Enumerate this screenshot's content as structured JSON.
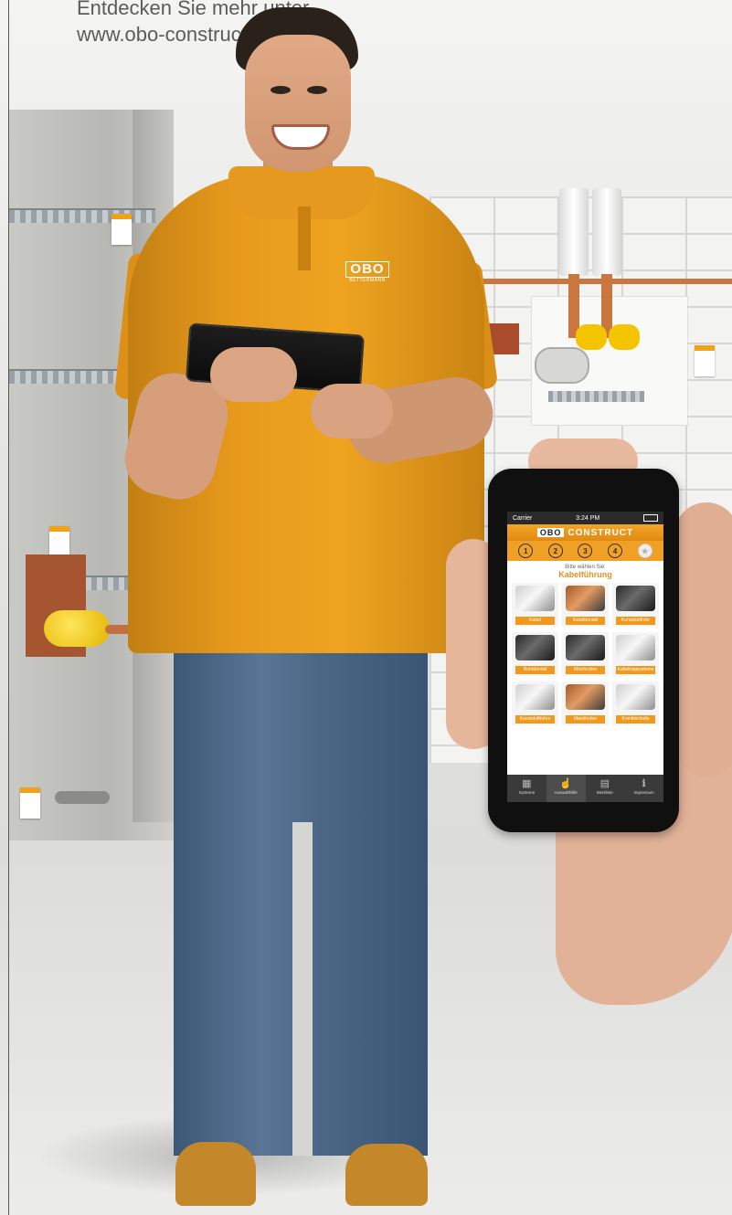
{
  "headline": {
    "line1": "Entdecken Sie mehr unter",
    "line2": "www.obo-construct.de"
  },
  "shirt_logo": {
    "mark": "OBO",
    "sub": "BETTERMANN"
  },
  "phone": {
    "status": {
      "carrier": "Carrier",
      "time": "3:24 PM"
    },
    "brand": {
      "logo": "OBO",
      "title": "CONSTRUCT"
    },
    "steps": [
      "1",
      "2",
      "3",
      "4",
      "★"
    ],
    "prompt": "Bitte wählen Sie:",
    "section_title": "Kabelführung",
    "tiles": [
      {
        "label": "Kabel",
        "style": "light"
      },
      {
        "label": "Kabelbündel",
        "style": "copper"
      },
      {
        "label": "Kunststoffrohr",
        "style": "dark"
      },
      {
        "label": "Rohrbündel",
        "style": "dark"
      },
      {
        "label": "Mischrohre",
        "style": "dark"
      },
      {
        "label": "Kabeltragsysteme",
        "style": "light"
      },
      {
        "label": "Kunststoffrohre",
        "style": "light"
      },
      {
        "label": "Metallrohre",
        "style": "copper"
      },
      {
        "label": "Kombischotts",
        "style": "light"
      }
    ],
    "tabs": [
      {
        "label": "Systeme",
        "icon": "grid-icon",
        "glyph": "▦",
        "active": false
      },
      {
        "label": "Auswahlhilfe",
        "icon": "hand-pointer-icon",
        "glyph": "☝",
        "active": true
      },
      {
        "label": "Merkliste",
        "icon": "notepad-icon",
        "glyph": "▤",
        "active": false
      },
      {
        "label": "Impressum",
        "icon": "info-icon",
        "glyph": "ℹ",
        "active": false
      }
    ]
  },
  "colors": {
    "accent": "#ef9a1e",
    "shirt": "#e79a1c",
    "tabbar": "#3a3a3a"
  }
}
